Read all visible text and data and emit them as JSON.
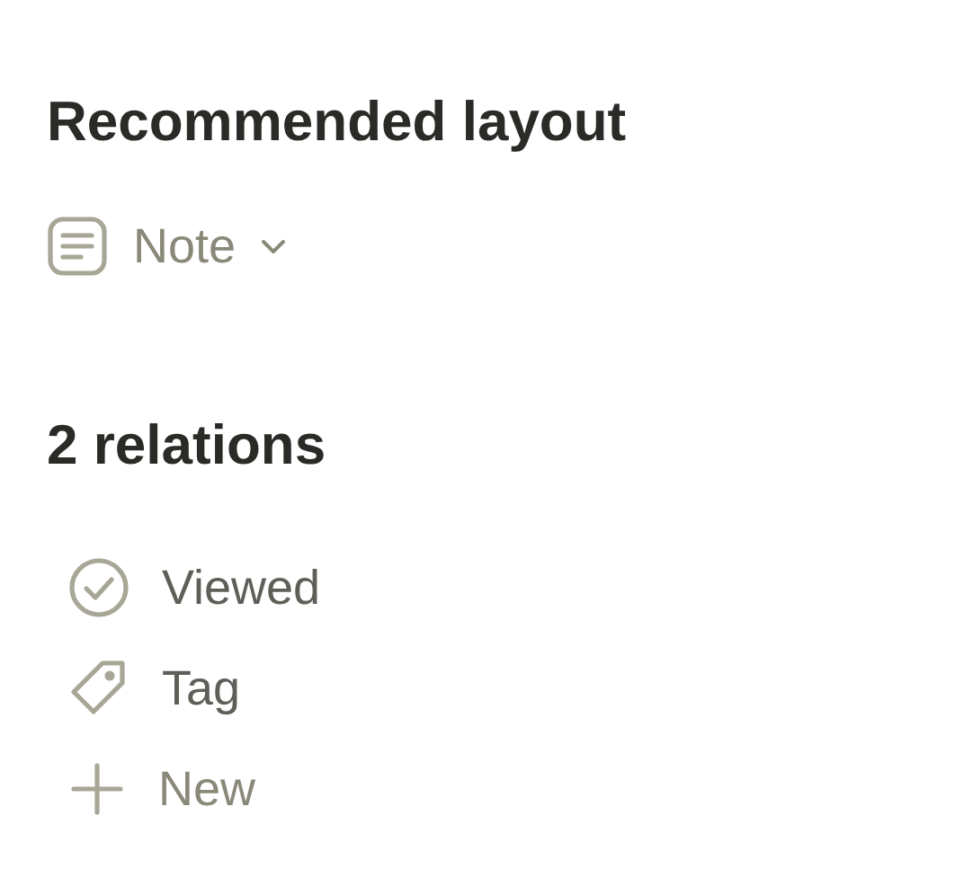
{
  "layout_section": {
    "heading": "Recommended layout",
    "selector": {
      "label": "Note"
    }
  },
  "relations_section": {
    "heading": "2 relations",
    "items": [
      {
        "kind": "check",
        "label": "Viewed"
      },
      {
        "kind": "tag",
        "label": "Tag"
      },
      {
        "kind": "add",
        "label": "New"
      }
    ]
  }
}
